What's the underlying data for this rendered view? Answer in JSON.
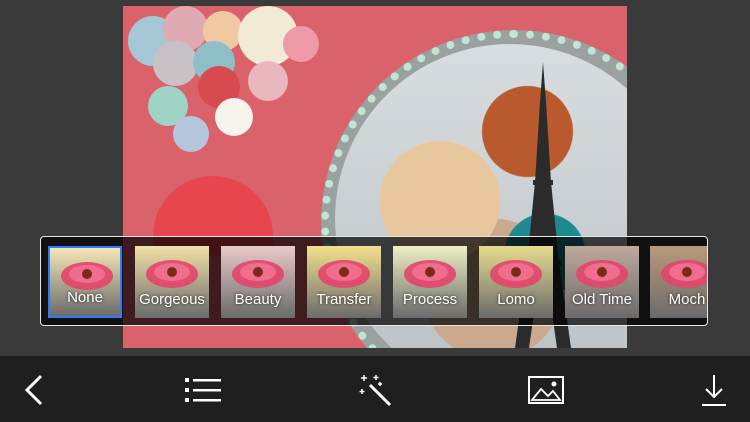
{
  "colors": {
    "accent": "#2e7bff",
    "toolbar_bg": "#1f1f1f",
    "canvas_bg": "#d9626b"
  },
  "filters": [
    {
      "label": "None",
      "selected": true,
      "tint": "#f4e7b5"
    },
    {
      "label": "Gorgeous",
      "selected": false,
      "tint": "#f1e2a8"
    },
    {
      "label": "Beauty",
      "selected": false,
      "tint": "#e9c9c9"
    },
    {
      "label": "Transfer",
      "selected": false,
      "tint": "#f3e08d"
    },
    {
      "label": "Process",
      "selected": false,
      "tint": "#eef0c4"
    },
    {
      "label": "Lomo",
      "selected": false,
      "tint": "#e6dc8e"
    },
    {
      "label": "Old Time",
      "selected": false,
      "tint": "#bfa99c"
    },
    {
      "label": "Moch",
      "selected": false,
      "tint": "#b89a7a"
    }
  ],
  "toolbar": {
    "icons": [
      "back-chevron-icon",
      "list-icon",
      "magic-wand-icon",
      "image-icon",
      "download-icon"
    ]
  }
}
